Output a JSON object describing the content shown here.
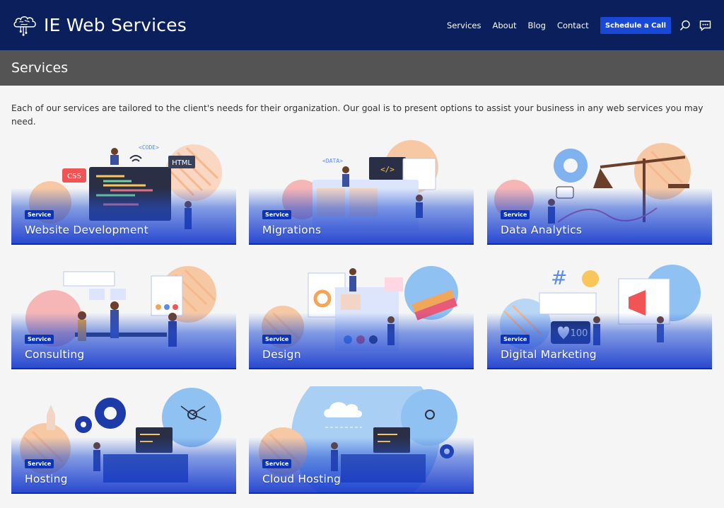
{
  "header": {
    "brand": "IE Web Services",
    "nav": [
      "Services",
      "About",
      "Blog",
      "Contact"
    ],
    "cta_label": "Schedule a Call"
  },
  "page": {
    "title": "Services",
    "intro": "Each of our services are tailored to the client's needs for their organization. Our goal is to present options to assist your business in any web services you may need."
  },
  "cards": [
    {
      "badge": "Service",
      "title": "Website Development",
      "art_labels": [
        "<CODE>",
        "HTML",
        "CSS"
      ]
    },
    {
      "badge": "Service",
      "title": "Migrations",
      "art_labels": [
        "<DATA>"
      ]
    },
    {
      "badge": "Service",
      "title": "Data Analytics",
      "art_labels": []
    },
    {
      "badge": "Service",
      "title": "Consulting",
      "art_labels": []
    },
    {
      "badge": "Service",
      "title": "Design",
      "art_labels": []
    },
    {
      "badge": "Service",
      "title": "Digital Marketing",
      "art_labels": [
        "100"
      ]
    },
    {
      "badge": "Service",
      "title": "Hosting",
      "art_labels": []
    },
    {
      "badge": "Service",
      "title": "Cloud Hosting",
      "art_labels": []
    }
  ],
  "colors": {
    "header_bg": "#0a1f5c",
    "title_bar_bg": "#545454",
    "accent": "#1749d6",
    "page_bg": "#f5f5f5"
  }
}
